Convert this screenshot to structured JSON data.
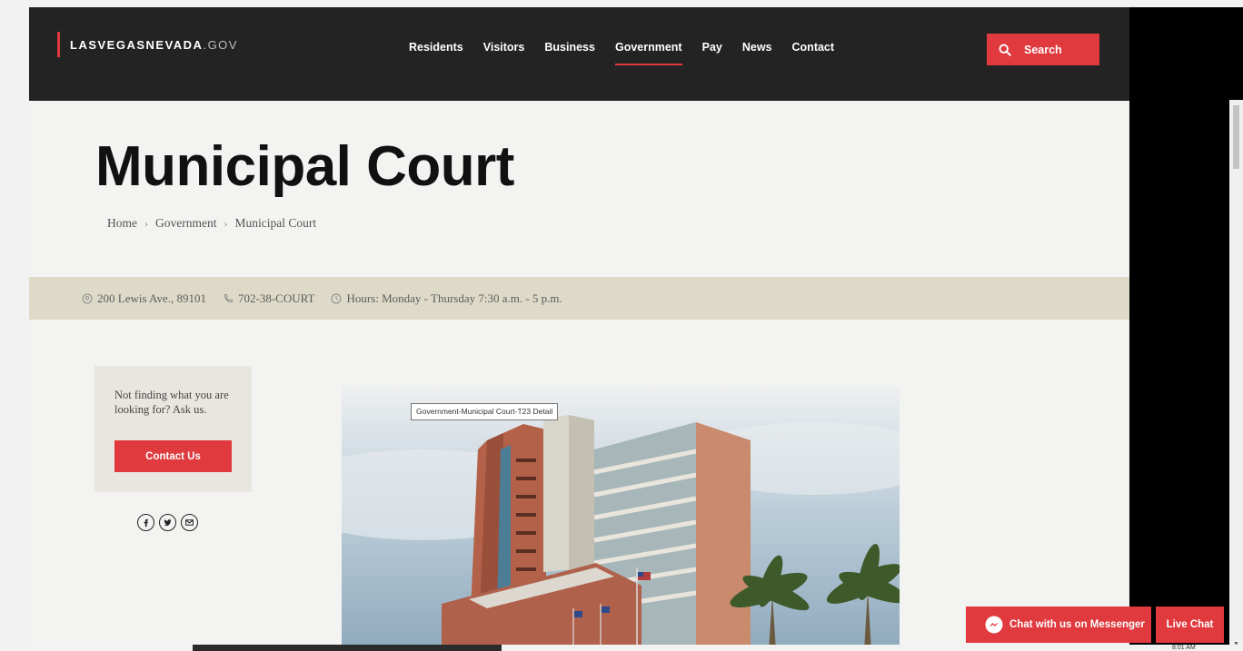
{
  "header": {
    "logo": {
      "bold": "LASVEGASNEVADA",
      "light": ".GOV"
    },
    "nav": [
      {
        "label": "Residents",
        "active": false
      },
      {
        "label": "Visitors",
        "active": false
      },
      {
        "label": "Business",
        "active": false
      },
      {
        "label": "Government",
        "active": true
      },
      {
        "label": "Pay",
        "active": false
      },
      {
        "label": "News",
        "active": false
      },
      {
        "label": "Contact",
        "active": false
      }
    ],
    "search_label": "Search"
  },
  "page": {
    "title": "Municipal Court",
    "breadcrumb": [
      "Home",
      "Government",
      "Municipal Court"
    ]
  },
  "info_bar": {
    "address": "200 Lewis Ave., 89101",
    "phone": "702-38-COURT",
    "hours": "Hours: Monday - Thursday 7:30 a.m. - 5 p.m."
  },
  "sidebar": {
    "ask_text": "Not finding what you are looking for? Ask us.",
    "contact_label": "Contact Us",
    "social": [
      "facebook-icon",
      "twitter-icon",
      "email-icon"
    ]
  },
  "photo": {
    "tooltip": "Government-Municipal Court-T23 Detail"
  },
  "chat": {
    "messenger_label": "Chat with us on Messenger",
    "livechat_label": "Live Chat"
  },
  "taskbar": {
    "clock": "8:01 AM"
  },
  "colors": {
    "accent": "#e0393e",
    "header_bg": "#232323",
    "info_bar_bg": "#dedac8"
  }
}
